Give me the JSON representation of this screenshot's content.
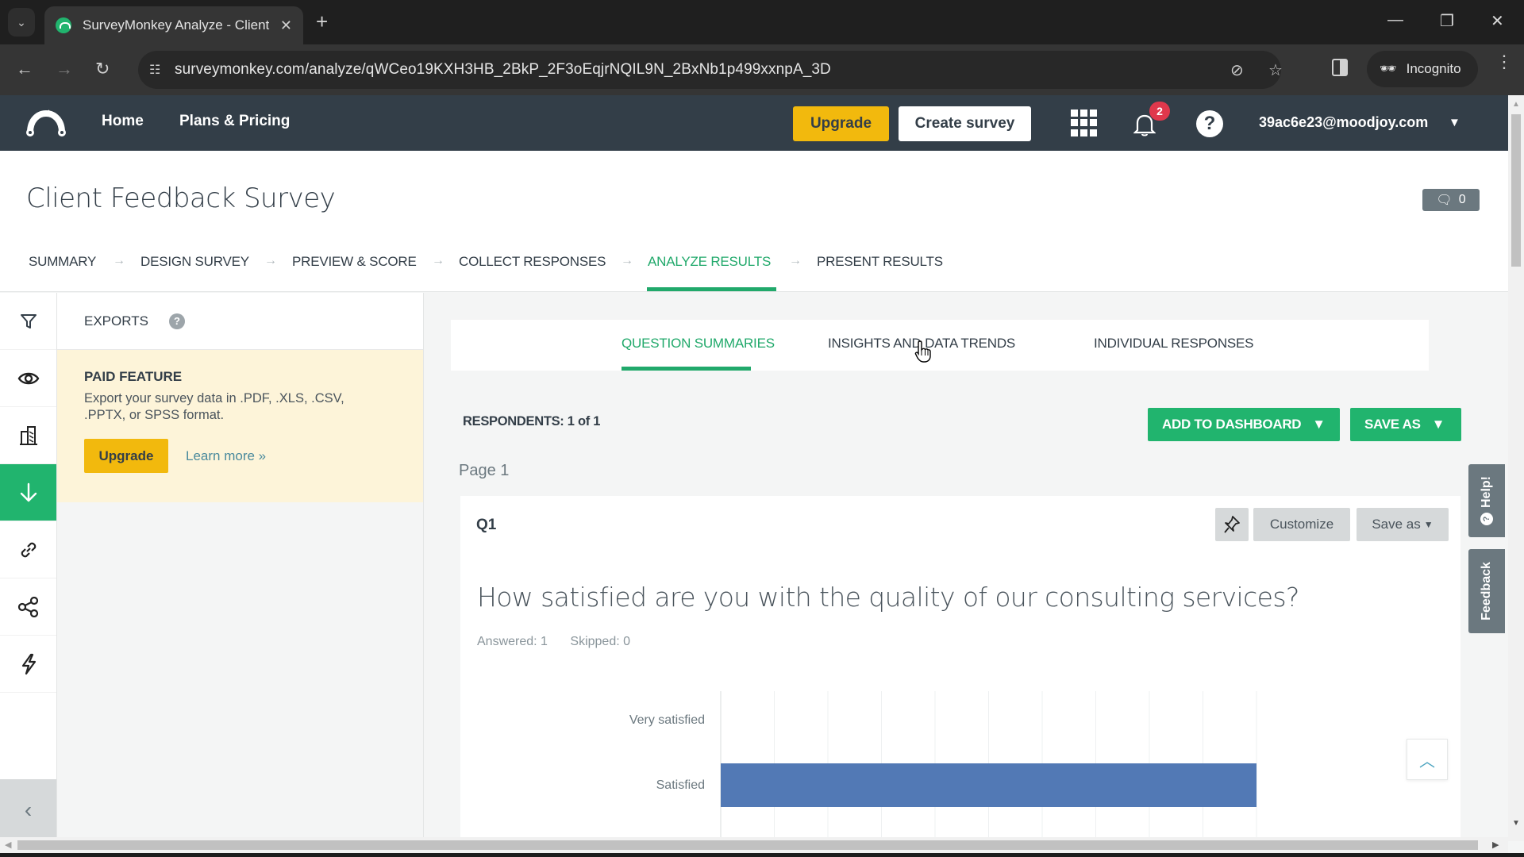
{
  "browser": {
    "tab_title": "SurveyMonkey Analyze - Client",
    "url": "surveymonkey.com/analyze/qWCeo19KXH3HB_2BkP_2F3oEqjrNQIL9N_2BxNb1p499xxnpA_3D",
    "incognito_label": "Incognito"
  },
  "header": {
    "nav": [
      "Home",
      "Plans & Pricing"
    ],
    "upgrade_label": "Upgrade",
    "create_label": "Create survey",
    "notification_count": "2",
    "help_glyph": "?",
    "account_email": "39ac6e23@moodjoy.com"
  },
  "survey": {
    "title": "Client Feedback Survey",
    "comment_count": "0"
  },
  "steps": [
    {
      "label": "SUMMARY",
      "active": false
    },
    {
      "label": "DESIGN SURVEY",
      "active": false
    },
    {
      "label": "PREVIEW & SCORE",
      "active": false
    },
    {
      "label": "COLLECT RESPONSES",
      "active": false
    },
    {
      "label": "ANALYZE RESULTS",
      "active": true
    },
    {
      "label": "PRESENT RESULTS",
      "active": false
    }
  ],
  "rail": [
    {
      "icon": "filter-icon",
      "active": false
    },
    {
      "icon": "eye-icon",
      "active": false
    },
    {
      "icon": "compare-icon",
      "active": false
    },
    {
      "icon": "download-icon",
      "active": true
    },
    {
      "icon": "link-icon",
      "active": false
    },
    {
      "icon": "share-icon",
      "active": false
    },
    {
      "icon": "lightning-icon",
      "active": false
    }
  ],
  "exports": {
    "heading": "EXPORTS",
    "help_glyph": "?",
    "paid_title": "PAID FEATURE",
    "paid_desc": "Export your survey data in .PDF, .XLS, .CSV, .PPTX, or SPSS format.",
    "upgrade_label": "Upgrade",
    "learn_more": "Learn more »"
  },
  "analyze": {
    "tabs": [
      {
        "label": "QUESTION SUMMARIES",
        "active": true
      },
      {
        "label": "INSIGHTS AND DATA TRENDS",
        "active": false
      },
      {
        "label": "INDIVIDUAL RESPONSES",
        "active": false
      }
    ],
    "respondents": "RESPONDENTS: 1 of 1",
    "add_dashboard_label": "ADD TO DASHBOARD",
    "save_as_label": "SAVE AS",
    "page_label": "Page 1"
  },
  "question": {
    "number": "Q1",
    "customize_label": "Customize",
    "save_as_label": "Save as",
    "text": "How satisfied are you with the quality of our consulting services?",
    "answered": "Answered: 1",
    "skipped": "Skipped: 0"
  },
  "side_tabs": {
    "help": "Help!",
    "feedback": "Feedback"
  },
  "colors": {
    "brand_green": "#21b46e",
    "header_dark": "#333e48",
    "upgrade_yellow": "#f2b90d",
    "bar_blue": "#5279b5",
    "badge_red": "#e0384c"
  },
  "chart_data": {
    "type": "bar",
    "orientation": "horizontal",
    "categories": [
      "Very satisfied",
      "Satisfied"
    ],
    "values": [
      0,
      100
    ],
    "unit": "%",
    "xlim": [
      0,
      100
    ],
    "gridlines": 10,
    "grid": true,
    "title": "",
    "xlabel": "",
    "ylabel": ""
  }
}
